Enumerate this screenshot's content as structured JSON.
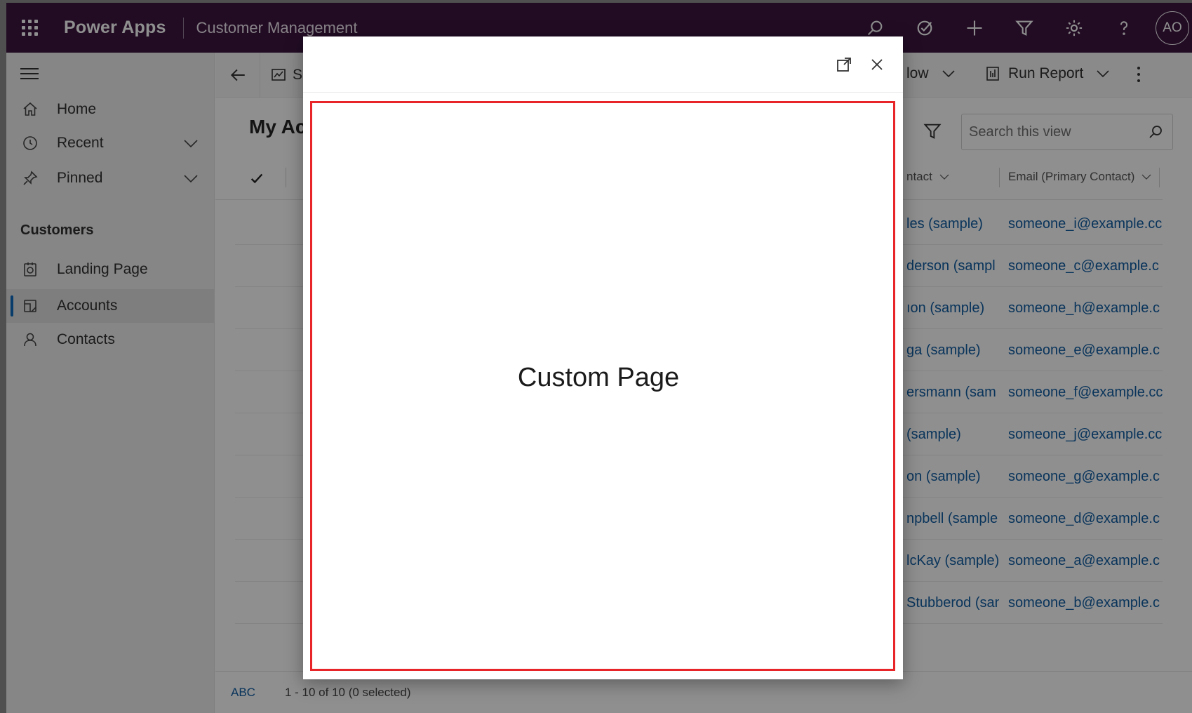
{
  "topbar": {
    "app_name": "Power Apps",
    "module_name": "Customer Management",
    "icons": [
      "search-icon",
      "task-check-icon",
      "add-icon",
      "filter-icon",
      "settings-icon",
      "help-icon"
    ],
    "avatar_initials": "AO",
    "background_color": "#3d1640"
  },
  "sidebar": {
    "items": [
      {
        "label": "Home",
        "icon": "home-icon"
      },
      {
        "label": "Recent",
        "icon": "clock-icon",
        "expandable": true
      },
      {
        "label": "Pinned",
        "icon": "pin-icon",
        "expandable": true
      }
    ],
    "group_title": "Customers",
    "group_items": [
      {
        "label": "Landing Page",
        "icon": "dashboard-icon"
      },
      {
        "label": "Accounts",
        "icon": "accounts-icon",
        "active": true
      },
      {
        "label": "Contacts",
        "icon": "person-icon"
      }
    ],
    "active_accent": "#0f6cbd"
  },
  "commandbar": {
    "partial_left_label": "S",
    "partial_flow_label": "low",
    "run_report_label": "Run Report"
  },
  "view": {
    "title_partial": "My Ac",
    "search_placeholder": "Search this view",
    "columns": {
      "contact_partial": "ntact",
      "email": "Email (Primary Contact)"
    },
    "rows": [
      {
        "contact": "les (sample)",
        "email": "someone_i@example.cc"
      },
      {
        "contact": "derson (sampl",
        "email": "someone_c@example.c"
      },
      {
        "contact": "ıon (sample)",
        "email": "someone_h@example.c"
      },
      {
        "contact": "ga (sample)",
        "email": "someone_e@example.c"
      },
      {
        "contact": "ersmann (sam",
        "email": "someone_f@example.cc"
      },
      {
        "contact": " (sample)",
        "email": "someone_j@example.cc"
      },
      {
        "contact": "on (sample)",
        "email": "someone_g@example.c"
      },
      {
        "contact": "npbell (sample",
        "email": "someone_d@example.c"
      },
      {
        "contact": "lcKay (sample)",
        "email": "someone_a@example.c"
      },
      {
        "contact": "Stubberod (san",
        "email": "someone_b@example.c"
      }
    ],
    "link_color": "#115ea3"
  },
  "footer": {
    "abc_label": "ABC",
    "record_count": "1 - 10 of 10 (0 selected)"
  },
  "modal": {
    "title": "Custom Page",
    "highlight_color": "#e8262a"
  }
}
